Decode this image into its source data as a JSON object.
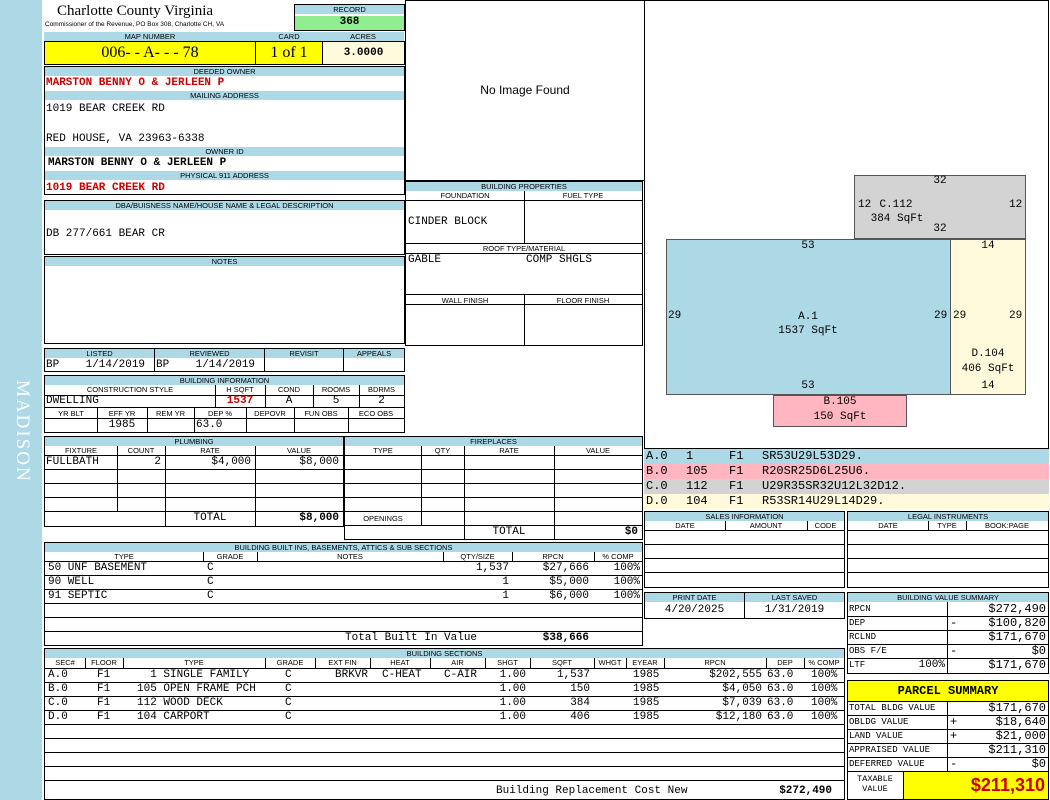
{
  "sidebar": {
    "district": "MADISON"
  },
  "header": {
    "county": "Charlotte County Virginia",
    "commissioner": "Commissioner of the Revenue, PO Box 308, Charlotte CH, VA",
    "record_label": "RECORD",
    "record": "368",
    "map_label": "MAP NUMBER",
    "map": "006- - A- - - 78",
    "card_label": "CARD",
    "card": "1 of 1",
    "acres_label": "ACRES",
    "acres": "3.0000"
  },
  "owner": {
    "deeded_label": "DEEDED OWNER",
    "deeded": "MARSTON BENNY O & JERLEEN P",
    "mailing_label": "MAILING ADDRESS",
    "mail1": "1019 BEAR CREEK RD",
    "mail2": "RED HOUSE, VA 23963-6338",
    "owner_id_label": "OWNER ID",
    "owner_id": "MARSTON BENNY O & JERLEEN P",
    "physical_label": "PHYSICAL 911 ADDRESS",
    "physical": "1019 BEAR CREEK RD",
    "dba_label": "DBA/BUISNESS NAME/HOUSE NAME & LEGAL DESCRIPTION",
    "dba": "DB 277/661 BEAR CR",
    "notes_label": "NOTES"
  },
  "image": {
    "none": "No Image Found"
  },
  "props": {
    "title": "BUILDING PROPERTIES",
    "foundation_label": "FOUNDATION",
    "foundation": "CINDER BLOCK",
    "fuel_label": "FUEL TYPE",
    "roof_label": "ROOF TYPE/MATERIAL",
    "roof1": "GABLE",
    "roof2": "COMP SHGLS",
    "wall_label": "WALL FINISH",
    "floor_label": "FLOOR FINISH"
  },
  "dates": {
    "listed_label": "LISTED",
    "listed": "BP    1/14/2019",
    "reviewed_label": "REVIEWED",
    "reviewed": "BP    1/14/2019",
    "revisit_label": "REVISIT",
    "appeals_label": "APPEALS"
  },
  "bi": {
    "title": "BUILDING INFORMATION",
    "cs_label": "CONSTRUCTION STYLE",
    "cs": "DWELLING",
    "hsqft_label": "H SQFT",
    "hsqft": "1537",
    "cond_label": "COND",
    "cond": "A",
    "rooms_label": "ROOMS",
    "rooms": "5",
    "bdrms_label": "BDRMS",
    "bdrms": "2",
    "yrblt_label": "YR BLT",
    "effyr_label": "EFF YR",
    "effyr": "1985",
    "remyr_label": "REM YR",
    "dep_label": "DEP %",
    "dep": "63.0",
    "depovr_label": "DEPOVR",
    "funobs_label": "FUN OBS",
    "ecoobs_label": "ECO OBS"
  },
  "plumbing": {
    "title": "PLUMBING",
    "h_fixture": "FIXTURE",
    "h_count": "COUNT",
    "h_rate": "RATE",
    "h_value": "VALUE",
    "fixture": "FULLBATH",
    "count": "2",
    "rate": "$4,000",
    "value": "$8,000",
    "total_label": "TOTAL",
    "total": "$8,000"
  },
  "fireplaces": {
    "title": "FIREPLACES",
    "h_type": "TYPE",
    "h_qty": "QTY",
    "h_rate": "RATE",
    "h_value": "VALUE",
    "openings_label": "OPENINGS",
    "total_label": "TOTAL",
    "total": "$0"
  },
  "builtins": {
    "title": "BUILDING BUILT INS, BASEMENTS, ATTICS & SUB SECTIONS",
    "h_type": "TYPE",
    "h_grade": "GRADE",
    "h_notes": "NOTES",
    "h_qty": "QTY/SIZE",
    "h_rpcn": "RPCN",
    "h_comp": "% COMP",
    "rows": [
      {
        "type": "50 UNF BASEMENT",
        "grade": "C",
        "qty": "1,537",
        "rpcn": "$27,666",
        "comp": "100%"
      },
      {
        "type": "90 WELL",
        "grade": "C",
        "qty": "1",
        "rpcn": "$5,000",
        "comp": "100%"
      },
      {
        "type": "91 SEPTIC",
        "grade": "C",
        "qty": "1",
        "rpcn": "$6,000",
        "comp": "100%"
      }
    ],
    "total_label": "Total Built In Value",
    "total": "$38,666"
  },
  "sections": {
    "title": "BUILDING SECTIONS",
    "h_sec": "SEC#",
    "h_floor": "FLOOR",
    "h_type": "TYPE",
    "h_grade": "GRADE",
    "h_extfin": "EXT FIN",
    "h_heat": "HEAT",
    "h_air": "AIR",
    "h_shgt": "SHGT",
    "h_sqft": "SQFT",
    "h_whgt": "WHGT",
    "h_eyear": "EYEAR",
    "h_rpcn": "RPCN",
    "h_dep": "DEP",
    "h_comp": "% COMP",
    "rows": [
      {
        "sec": "A.0",
        "floor": "F1",
        "type": "  1 SINGLE FAMILY",
        "grade": "C",
        "extfin": "BRKVR",
        "heat": "C-HEAT",
        "air": "C-AIR",
        "shgt": "1.00",
        "sqft": "1,537",
        "eyear": "1985",
        "rpcn": "$202,555",
        "dep": "63.0",
        "comp": "100%"
      },
      {
        "sec": "B.0",
        "floor": "F1",
        "type": "105 OPEN FRAME PCH",
        "grade": "C",
        "extfin": "",
        "heat": "",
        "air": "",
        "shgt": "1.00",
        "sqft": "150",
        "eyear": "1985",
        "rpcn": "$4,050",
        "dep": "63.0",
        "comp": "100%"
      },
      {
        "sec": "C.0",
        "floor": "F1",
        "type": "112 WOOD DECK",
        "grade": "C",
        "extfin": "",
        "heat": "",
        "air": "",
        "shgt": "1.00",
        "sqft": "384",
        "eyear": "1985",
        "rpcn": "$7,039",
        "dep": "63.0",
        "comp": "100%"
      },
      {
        "sec": "D.0",
        "floor": "F1",
        "type": "104 CARPORT",
        "grade": "C",
        "extfin": "",
        "heat": "",
        "air": "",
        "shgt": "1.00",
        "sqft": "406",
        "eyear": "1985",
        "rpcn": "$12,180",
        "dep": "63.0",
        "comp": "100%"
      }
    ],
    "brcn_label": "Building Replacement Cost New",
    "brcn": "$272,490"
  },
  "sketch": {
    "A": {
      "label": "A.1",
      "sqft": "1537 SqFt",
      "top": "53",
      "bottom": "53",
      "left": "29",
      "right": "29"
    },
    "B": {
      "label": "B.105",
      "sqft": "150 SqFt"
    },
    "C": {
      "label": "C.112",
      "sqft": "384 SqFt",
      "top": "32",
      "bottom": "32",
      "left": "12",
      "right": "12"
    },
    "D": {
      "label": "D.104",
      "sqft": "406 SqFt",
      "top": "14",
      "bottom": "14",
      "left": "29",
      "right": "29"
    },
    "colors": {
      "A": "#add8e6",
      "B": "#ffb6c1",
      "C": "#d3d3d3",
      "D": "#fffadc"
    }
  },
  "legend": [
    {
      "sec": "A.0",
      "code": "1",
      "floor": "F1",
      "path": "SR53U29L53D29."
    },
    {
      "sec": "B.0",
      "code": "105",
      "floor": "F1",
      "path": "R20SR25D6L25U6."
    },
    {
      "sec": "C.0",
      "code": "112",
      "floor": "F1",
      "path": "U29R35SR32U12L32D12."
    },
    {
      "sec": "D.0",
      "code": "104",
      "floor": "F1",
      "path": "R53SR14U29L14D29."
    }
  ],
  "sales": {
    "title": "SALES INFORMATION",
    "h_date": "DATE",
    "h_amount": "AMOUNT",
    "h_code": "CODE"
  },
  "legal": {
    "title": "LEGAL INSTRUMENTS",
    "h_date": "DATE",
    "h_type": "TYPE",
    "h_book": "BOOK:PAGE"
  },
  "print": {
    "print_label": "PRINT DATE",
    "print": "4/20/2025",
    "saved_label": "LAST SAVED",
    "saved": "1/31/2019"
  },
  "bvs": {
    "title": "BUILDING VALUE SUMMARY",
    "rows": [
      {
        "label": "RPCN",
        "sign": "",
        "val": "$272,490"
      },
      {
        "label": "DEP",
        "sign": "-",
        "val": "$100,820"
      },
      {
        "label": "RCLND",
        "sign": "",
        "val": "$171,670"
      },
      {
        "label": "OBS F/E",
        "sign": "-",
        "val": "$0"
      },
      {
        "label": "LTF",
        "pct": "100%",
        "sign": "",
        "val": "$171,670"
      }
    ]
  },
  "ps": {
    "title": "PARCEL SUMMARY",
    "rows": [
      {
        "label": "TOTAL BLDG VALUE",
        "sign": "",
        "val": "$171,670"
      },
      {
        "label": "OBLDG VALUE",
        "sign": "+",
        "val": "$18,640"
      },
      {
        "label": "LAND VALUE",
        "sign": "+",
        "val": "$21,000"
      },
      {
        "label": "APPRAISED VALUE",
        "sign": "",
        "val": "$211,310"
      },
      {
        "label": "DEFERRED VALUE",
        "sign": "-",
        "val": "$0"
      }
    ],
    "taxable_label": "TAXABLE VALUE",
    "taxable": "$211,310"
  }
}
